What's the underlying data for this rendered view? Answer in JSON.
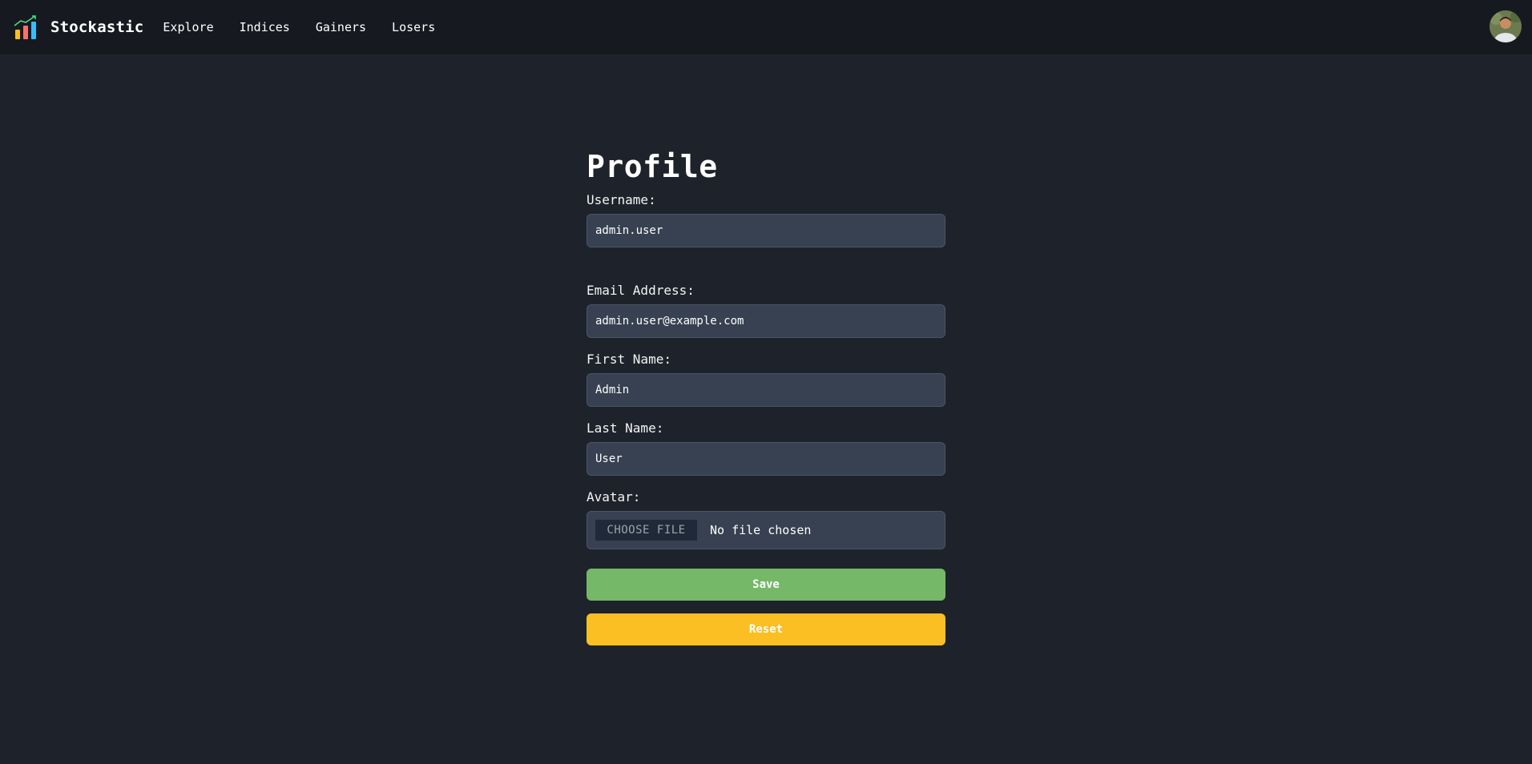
{
  "app": {
    "name": "Stockastic",
    "logo_icon": "bar-chart-trend-icon"
  },
  "nav": {
    "items": [
      {
        "label": "Explore"
      },
      {
        "label": "Indices"
      },
      {
        "label": "Gainers"
      },
      {
        "label": "Losers"
      }
    ],
    "avatar_icon": "user-avatar"
  },
  "profile": {
    "title": "Profile",
    "username": {
      "label": "Username:",
      "value": "admin.user"
    },
    "email": {
      "label": "Email Address:",
      "value": "admin.user@example.com"
    },
    "first_name": {
      "label": "First Name:",
      "value": "Admin"
    },
    "last_name": {
      "label": "Last Name:",
      "value": "User"
    },
    "avatar": {
      "label": "Avatar:",
      "button": "CHOOSE FILE",
      "status": "No file chosen"
    },
    "save_label": "Save",
    "reset_label": "Reset"
  },
  "colors": {
    "background": "#1e232b",
    "navbar": "#161a20",
    "input": "#374151",
    "save": "#74b868",
    "reset": "#fbbf24"
  }
}
